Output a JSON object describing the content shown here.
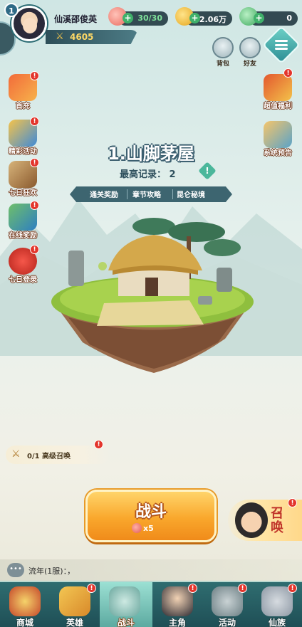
{
  "player": {
    "level": "1",
    "name": "仙溪邵俊英",
    "power": "4605"
  },
  "resources": {
    "stamina": "30/30",
    "gold": "2.06万",
    "gems": "0"
  },
  "top_icons": [
    {
      "label": "背包",
      "icon": "backpack-icon"
    },
    {
      "label": "好友",
      "icon": "friends-icon"
    }
  ],
  "left_menu": [
    {
      "label": "首充",
      "badge": "!",
      "icon": "first-recharge-icon"
    },
    {
      "label": "精彩活动",
      "badge": "!",
      "icon": "events-icon"
    },
    {
      "label": "七日狂欢",
      "badge": "!",
      "icon": "seven-day-carnival-icon"
    },
    {
      "label": "在线奖励",
      "badge": "!",
      "icon": "online-reward-icon"
    },
    {
      "label": "七日登录",
      "badge": "!",
      "icon": "seven-day-login-icon"
    }
  ],
  "right_menu": [
    {
      "label": "超值福利",
      "badge": "!",
      "icon": "treasure-chest-icon"
    },
    {
      "label": "系统预告",
      "badge": "",
      "icon": "system-preview-icon"
    }
  ],
  "stage": {
    "title": "1.山脚茅屋",
    "best_record_label": "最高记录：",
    "best_record_value": "2",
    "tabs": [
      "通关奖励",
      "章节攻略",
      "昆仑秘境"
    ]
  },
  "summon_progress": {
    "text": "0/1 高级召唤",
    "badge": "!"
  },
  "battle": {
    "label": "战斗",
    "cost": "x5"
  },
  "summon": {
    "label": "召唤",
    "badge": "!"
  },
  "chat": {
    "icon_text": "•••",
    "message": "流年(1服)：，"
  },
  "bottom_nav": [
    {
      "label": "商城",
      "icon": "shop-icon",
      "badge": ""
    },
    {
      "label": "英雄",
      "icon": "heroes-icon",
      "badge": "!"
    },
    {
      "label": "战斗",
      "icon": "battle-icon",
      "badge": "",
      "active": true
    },
    {
      "label": "主角",
      "icon": "protagonist-icon",
      "badge": "!"
    },
    {
      "label": "活动",
      "icon": "activity-icon",
      "badge": "!"
    },
    {
      "label": "仙族",
      "icon": "clan-icon",
      "badge": "!"
    }
  ],
  "colors": {
    "accent": "#2f6d70",
    "battle_button": "#f9a72c",
    "badge_red": "#e3352c"
  }
}
